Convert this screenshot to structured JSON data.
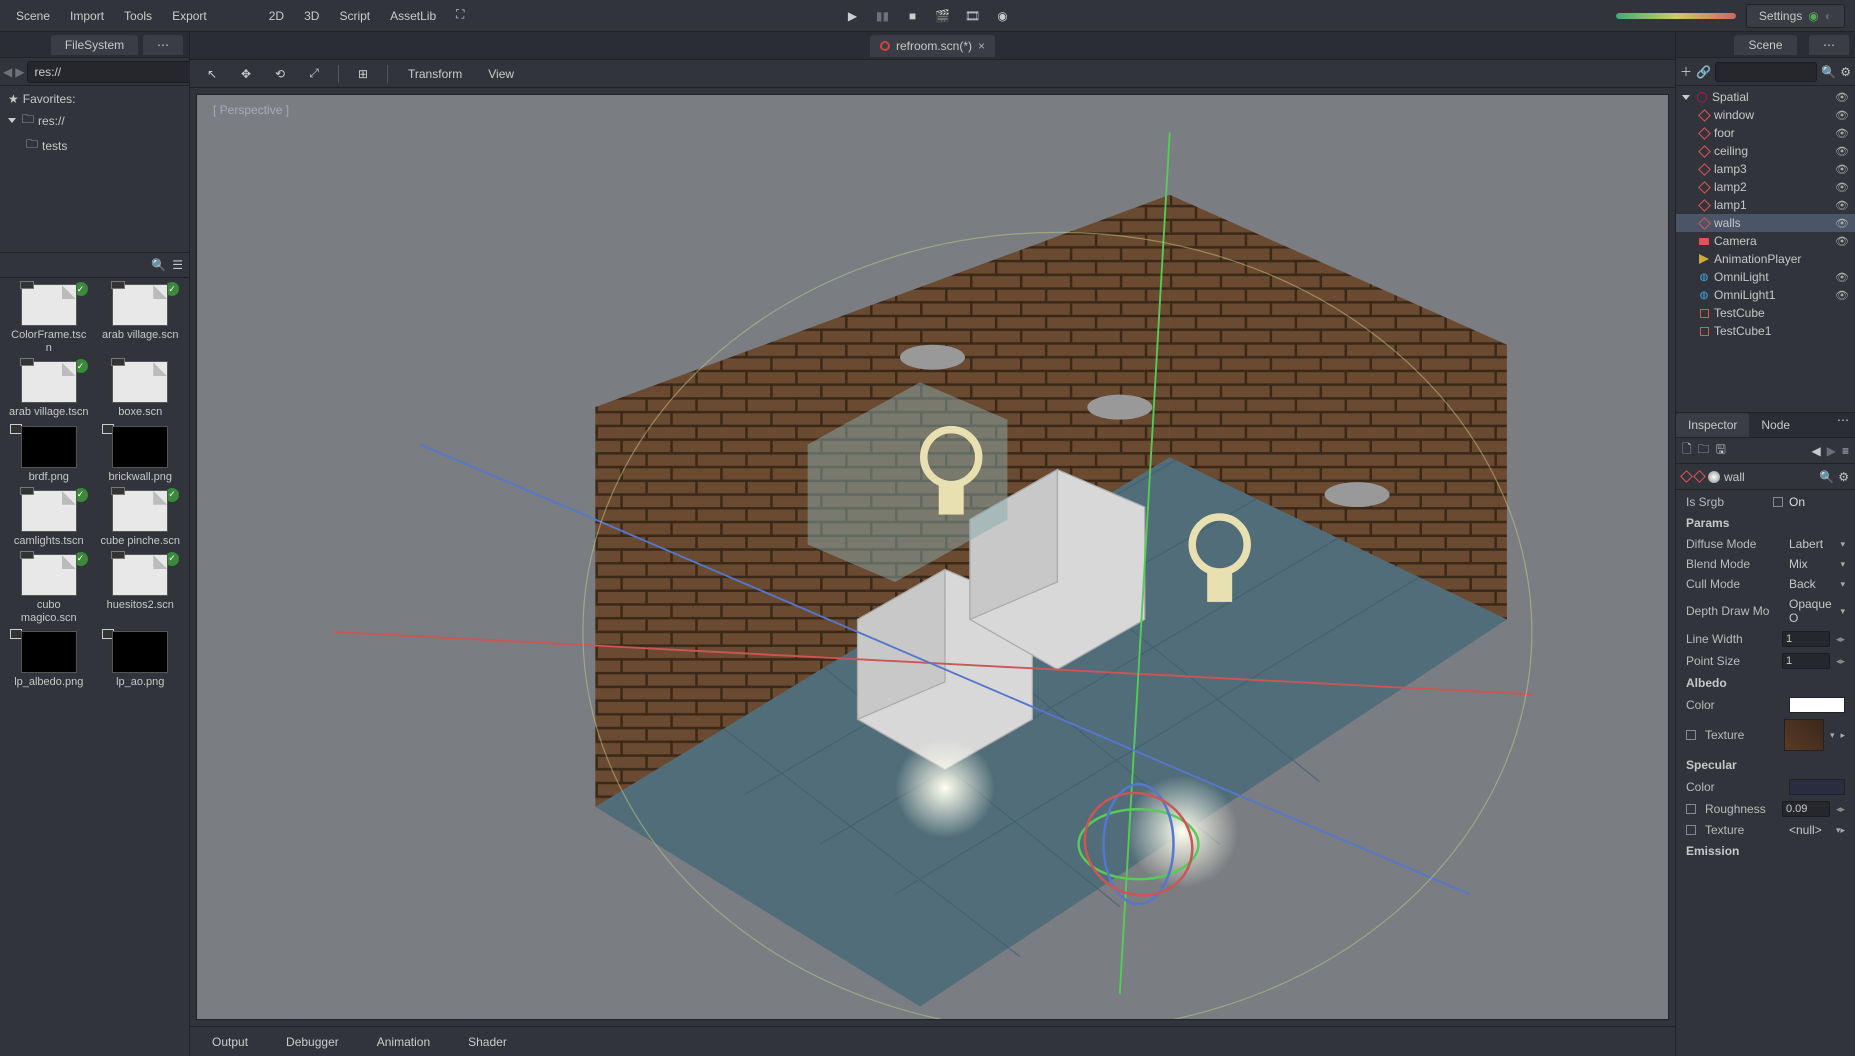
{
  "menubar": {
    "scene": "Scene",
    "import": "Import",
    "tools": "Tools",
    "export": "Export",
    "mode_2d": "2D",
    "mode_3d": "3D",
    "mode_script": "Script",
    "mode_assetlib": "AssetLib"
  },
  "settings_label": "Settings",
  "filesystem": {
    "title": "FileSystem",
    "path": "res://",
    "favorites": "Favorites:",
    "root": "res://",
    "root_children": [
      "tests"
    ],
    "files": [
      {
        "name": "ColorFrame.tscn",
        "kind": "scene",
        "check": true
      },
      {
        "name": "arab village.scn",
        "kind": "scene",
        "check": true
      },
      {
        "name": "arab village.tscn",
        "kind": "scene",
        "check": true
      },
      {
        "name": "boxe.scn",
        "kind": "scene",
        "check": false
      },
      {
        "name": "brdf.png",
        "kind": "img",
        "check": false
      },
      {
        "name": "brickwall.png",
        "kind": "img",
        "check": false
      },
      {
        "name": "camlights.tscn",
        "kind": "scene",
        "check": true
      },
      {
        "name": "cube pinche.scn",
        "kind": "scene",
        "check": true
      },
      {
        "name": "cubo magico.scn",
        "kind": "scene",
        "check": true
      },
      {
        "name": "huesitos2.scn",
        "kind": "scene",
        "check": true
      },
      {
        "name": "lp_albedo.png",
        "kind": "img",
        "check": false
      },
      {
        "name": "lp_ao.png",
        "kind": "img",
        "check": false
      }
    ]
  },
  "open_tab": {
    "name": "refroom.scn(*)"
  },
  "viewport_toolbar": {
    "transform": "Transform",
    "view": "View"
  },
  "perspective_label": "[ Perspective ]",
  "bottom_panel": {
    "output": "Output",
    "debugger": "Debugger",
    "animation": "Animation",
    "shader": "Shader"
  },
  "scene_dock": {
    "title": "Scene",
    "nodes": [
      {
        "name": "Spatial",
        "type": "spatial",
        "indent": 0,
        "vis": true,
        "expanded": true
      },
      {
        "name": "window",
        "type": "mesh",
        "indent": 1,
        "vis": true
      },
      {
        "name": "foor",
        "type": "mesh",
        "indent": 1,
        "vis": true
      },
      {
        "name": "ceiling",
        "type": "mesh",
        "indent": 1,
        "vis": true
      },
      {
        "name": "lamp3",
        "type": "mesh",
        "indent": 1,
        "vis": true
      },
      {
        "name": "lamp2",
        "type": "mesh",
        "indent": 1,
        "vis": true
      },
      {
        "name": "lamp1",
        "type": "mesh",
        "indent": 1,
        "vis": true
      },
      {
        "name": "walls",
        "type": "mesh",
        "indent": 1,
        "vis": true,
        "selected": true
      },
      {
        "name": "Camera",
        "type": "camera",
        "indent": 1,
        "vis": true
      },
      {
        "name": "AnimationPlayer",
        "type": "anim",
        "indent": 1,
        "vis": false
      },
      {
        "name": "OmniLight",
        "type": "light",
        "indent": 1,
        "vis": true
      },
      {
        "name": "OmniLight1",
        "type": "light",
        "indent": 1,
        "vis": true
      },
      {
        "name": "TestCube",
        "type": "cube",
        "indent": 1,
        "vis": false
      },
      {
        "name": "TestCube1",
        "type": "cube",
        "indent": 1,
        "vis": false
      }
    ]
  },
  "inspector": {
    "tab_inspector": "Inspector",
    "tab_node": "Node",
    "object": "wall",
    "is_srgb_label": "Is Srgb",
    "is_srgb_value": "On",
    "params_hdr": "Params",
    "diffuse_mode": {
      "label": "Diffuse Mode",
      "value": "Labert"
    },
    "blend_mode": {
      "label": "Blend Mode",
      "value": "Mix"
    },
    "cull_mode": {
      "label": "Cull Mode",
      "value": "Back"
    },
    "depth_draw": {
      "label": "Depth Draw Mo",
      "value": "Opaque O"
    },
    "line_width": {
      "label": "Line Width",
      "value": "1"
    },
    "point_size": {
      "label": "Point Size",
      "value": "1"
    },
    "albedo_hdr": "Albedo",
    "albedo_color": "Color",
    "albedo_texture": "Texture",
    "specular_hdr": "Specular",
    "specular_color": "Color",
    "roughness": {
      "label": "Roughness",
      "value": "0.09"
    },
    "specular_texture": {
      "label": "Texture",
      "value": "<null>"
    },
    "emission_hdr": "Emission"
  }
}
